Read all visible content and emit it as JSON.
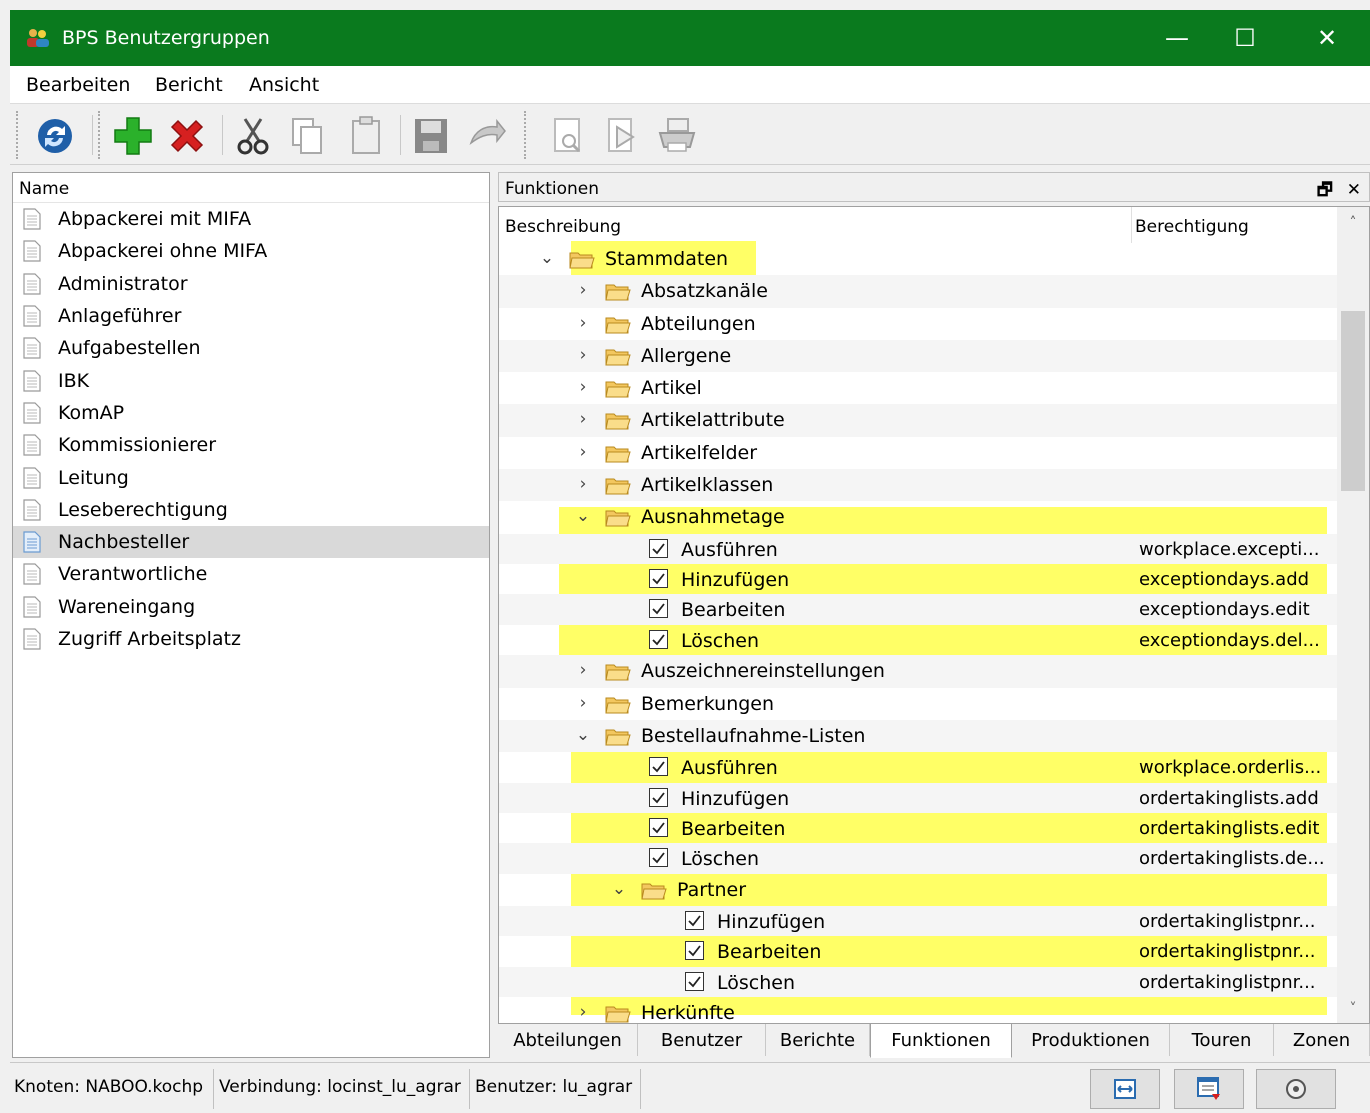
{
  "window": {
    "title": "BPS Benutzergruppen",
    "controls": [
      "—",
      "☐",
      "✕"
    ]
  },
  "menu": [
    "Bearbeiten",
    "Bericht",
    "Ansicht"
  ],
  "left": {
    "header": "Name",
    "items": [
      "Abpackerei mit MIFA",
      "Abpackerei ohne MIFA",
      "Administrator",
      "Anlageführer",
      "Aufgabestellen",
      "IBK",
      "KomAP",
      "Kommissionierer",
      "Leitung",
      "Leseberechtigung",
      "Nachbesteller",
      "Verantwortliche",
      "Wareneingang",
      "Zugriff Arbeitsplatz"
    ],
    "selected": "Nachbesteller"
  },
  "panel": {
    "title": "Funktionen",
    "buttons": [
      "🗗",
      "✕"
    ],
    "columns": [
      "Beschreibung",
      "Berechtigung"
    ],
    "rows": [
      {
        "level": 0,
        "type": "folder",
        "expanded": true,
        "label": "Stammdaten",
        "perm": ""
      },
      {
        "level": 1,
        "type": "folder",
        "expanded": false,
        "label": "Absatzkanäle",
        "perm": ""
      },
      {
        "level": 1,
        "type": "folder",
        "expanded": false,
        "label": "Abteilungen",
        "perm": ""
      },
      {
        "level": 1,
        "type": "folder",
        "expanded": false,
        "label": "Allergene",
        "perm": ""
      },
      {
        "level": 1,
        "type": "folder",
        "expanded": false,
        "label": "Artikel",
        "perm": ""
      },
      {
        "level": 1,
        "type": "folder",
        "expanded": false,
        "label": "Artikelattribute",
        "perm": ""
      },
      {
        "level": 1,
        "type": "folder",
        "expanded": false,
        "label": "Artikelfelder",
        "perm": ""
      },
      {
        "level": 1,
        "type": "folder",
        "expanded": false,
        "label": "Artikelklassen",
        "perm": ""
      },
      {
        "level": 1,
        "type": "folder",
        "expanded": true,
        "label": "Ausnahmetage",
        "perm": ""
      },
      {
        "level": 2,
        "type": "check",
        "label": "Ausführen",
        "perm": "workplace.excepti..."
      },
      {
        "level": 2,
        "type": "check",
        "label": "Hinzufügen",
        "perm": "exceptiondays.add"
      },
      {
        "level": 2,
        "type": "check",
        "label": "Bearbeiten",
        "perm": "exceptiondays.edit"
      },
      {
        "level": 2,
        "type": "check",
        "label": "Löschen",
        "perm": "exceptiondays.del..."
      },
      {
        "level": 1,
        "type": "folder",
        "expanded": false,
        "label": "Auszeichnereinstellungen",
        "perm": ""
      },
      {
        "level": 1,
        "type": "folder",
        "expanded": false,
        "label": "Bemerkungen",
        "perm": ""
      },
      {
        "level": 1,
        "type": "folder",
        "expanded": true,
        "label": "Bestellaufnahme-Listen",
        "perm": ""
      },
      {
        "level": 2,
        "type": "check",
        "label": "Ausführen",
        "perm": "workplace.orderlis..."
      },
      {
        "level": 2,
        "type": "check",
        "label": "Hinzufügen",
        "perm": "ordertakinglists.add"
      },
      {
        "level": 2,
        "type": "check",
        "label": "Bearbeiten",
        "perm": "ordertakinglists.edit"
      },
      {
        "level": 2,
        "type": "check",
        "label": "Löschen",
        "perm": "ordertakinglists.de..."
      },
      {
        "level": 2,
        "type": "folder",
        "expanded": true,
        "label": "Partner",
        "perm": ""
      },
      {
        "level": 3,
        "type": "check",
        "label": "Hinzufügen",
        "perm": "ordertakinglistpnr..."
      },
      {
        "level": 3,
        "type": "check",
        "label": "Bearbeiten",
        "perm": "ordertakinglistpnr..."
      },
      {
        "level": 3,
        "type": "check",
        "label": "Löschen",
        "perm": "ordertakinglistpnr..."
      },
      {
        "level": 1,
        "type": "folder",
        "expanded": false,
        "label": "Herkünfte",
        "perm": ""
      }
    ]
  },
  "tabs": [
    "Abteilungen",
    "Benutzer",
    "Berichte",
    "Funktionen",
    "Produktionen",
    "Touren",
    "Zonen"
  ],
  "active_tab": "Funktionen",
  "status": {
    "node": "Knoten: NABOO.kochp",
    "connection": "Verbindung: locinst_lu_agrar",
    "user": "Benutzer: lu_agrar"
  },
  "colors": {
    "titlebar": "#0a7a1e",
    "highlight": "#ffff66",
    "selection": "#d9d9d9"
  }
}
